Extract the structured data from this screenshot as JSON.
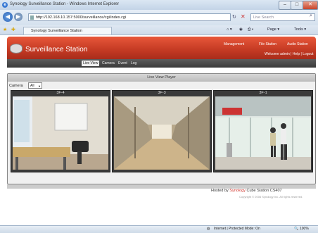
{
  "window": {
    "title": "Synology Surveillance Station - Windows Internet Explorer"
  },
  "browser": {
    "url": "http://192.168.10.157:5000/surveillance/cgi/index.cgi",
    "search_placeholder": "Live Search",
    "tab_title": "Synology Surveillance Station",
    "commands": {
      "page": "Page ▾",
      "tools": "Tools ▾"
    }
  },
  "app": {
    "title": "Surveillance Station",
    "header_links": [
      "Management",
      "File Station",
      "Audio Station"
    ],
    "welcome": "Welcome admin | Help | Logout",
    "nav_tabs": [
      {
        "label": "Live View",
        "active": true
      },
      {
        "label": "Camera",
        "active": false
      },
      {
        "label": "Event",
        "active": false
      },
      {
        "label": "Log",
        "active": false
      }
    ],
    "panel_title": "Live View Player",
    "camera_filter": {
      "label": "Camera",
      "value": "All"
    },
    "cameras": [
      {
        "name": "3F-4"
      },
      {
        "name": "3F-3"
      },
      {
        "name": "3F-1"
      }
    ]
  },
  "footer": {
    "hosted_prefix": "Hosted by ",
    "hosted_brand": "Synology",
    "hosted_suffix": " Cube Station CS407",
    "copyright": "Copyright © 2006 Synology Inc. All rights reserved."
  },
  "statusbar": {
    "zone": "Internet | Protected Mode: On",
    "zoom": "100%"
  }
}
